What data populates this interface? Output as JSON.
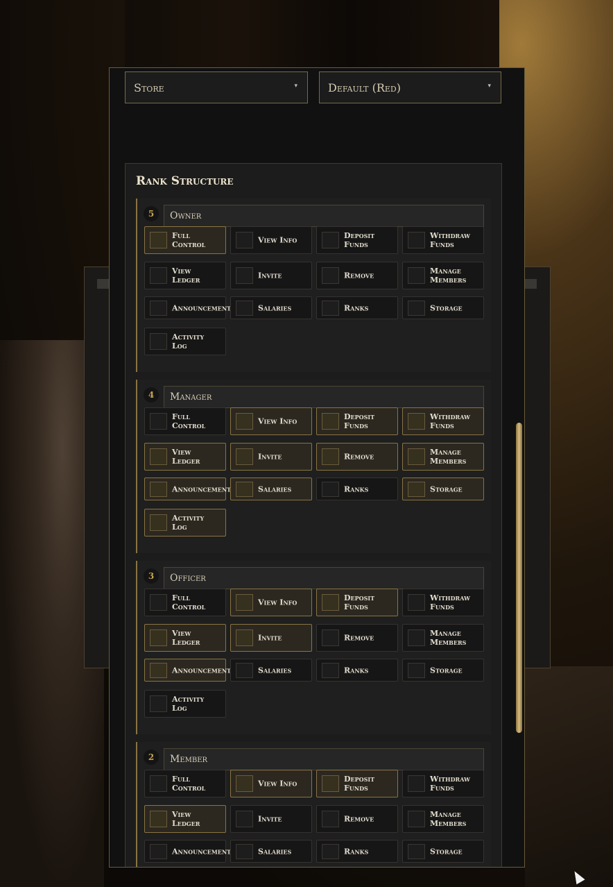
{
  "dropdowns": {
    "type": {
      "value": "Store"
    },
    "color": {
      "value": "Default (Red)"
    }
  },
  "rank_section": {
    "title": "Rank Structure"
  },
  "permission_labels": {
    "full_control": "Full\nControl",
    "view_info": "View Info",
    "deposit_funds": "Deposit\nFunds",
    "withdraw_funds": "Withdraw\nFunds",
    "view_ledger": "View\nLedger",
    "invite": "Invite",
    "remove": "Remove",
    "manage_members": "Manage\nMembers",
    "announcements": "Announcements",
    "salaries": "Salaries",
    "ranks": "Ranks",
    "storage": "Storage",
    "activity_log": "Activity\nLog"
  },
  "ranks": [
    {
      "number": "5",
      "name": "Owner",
      "checked": {
        "full_control": true,
        "view_info": false,
        "deposit_funds": false,
        "withdraw_funds": false,
        "view_ledger": false,
        "invite": false,
        "remove": false,
        "manage_members": false,
        "announcements": false,
        "salaries": false,
        "ranks": false,
        "storage": false,
        "activity_log": false
      }
    },
    {
      "number": "4",
      "name": "Manager",
      "checked": {
        "full_control": false,
        "view_info": true,
        "deposit_funds": true,
        "withdraw_funds": true,
        "view_ledger": true,
        "invite": true,
        "remove": true,
        "manage_members": true,
        "announcements": true,
        "salaries": true,
        "ranks": false,
        "storage": true,
        "activity_log": true
      }
    },
    {
      "number": "3",
      "name": "Officer",
      "checked": {
        "full_control": false,
        "view_info": true,
        "deposit_funds": true,
        "withdraw_funds": false,
        "view_ledger": true,
        "invite": true,
        "remove": false,
        "manage_members": false,
        "announcements": true,
        "salaries": false,
        "ranks": false,
        "storage": false,
        "activity_log": false
      }
    },
    {
      "number": "2",
      "name": "Member",
      "checked": {
        "full_control": false,
        "view_info": true,
        "deposit_funds": true,
        "withdraw_funds": false,
        "view_ledger": true,
        "invite": false,
        "remove": false,
        "manage_members": false,
        "announcements": false,
        "salaries": false,
        "ranks": false,
        "storage": false
      }
    }
  ],
  "icons": {
    "dropdown_caret": "caret-down-icon",
    "cursor": "mouse-cursor-icon"
  },
  "colors": {
    "accent": "#c9a24f",
    "panel_bg": "#111111",
    "scroll_thumb": "#d8bc80"
  }
}
